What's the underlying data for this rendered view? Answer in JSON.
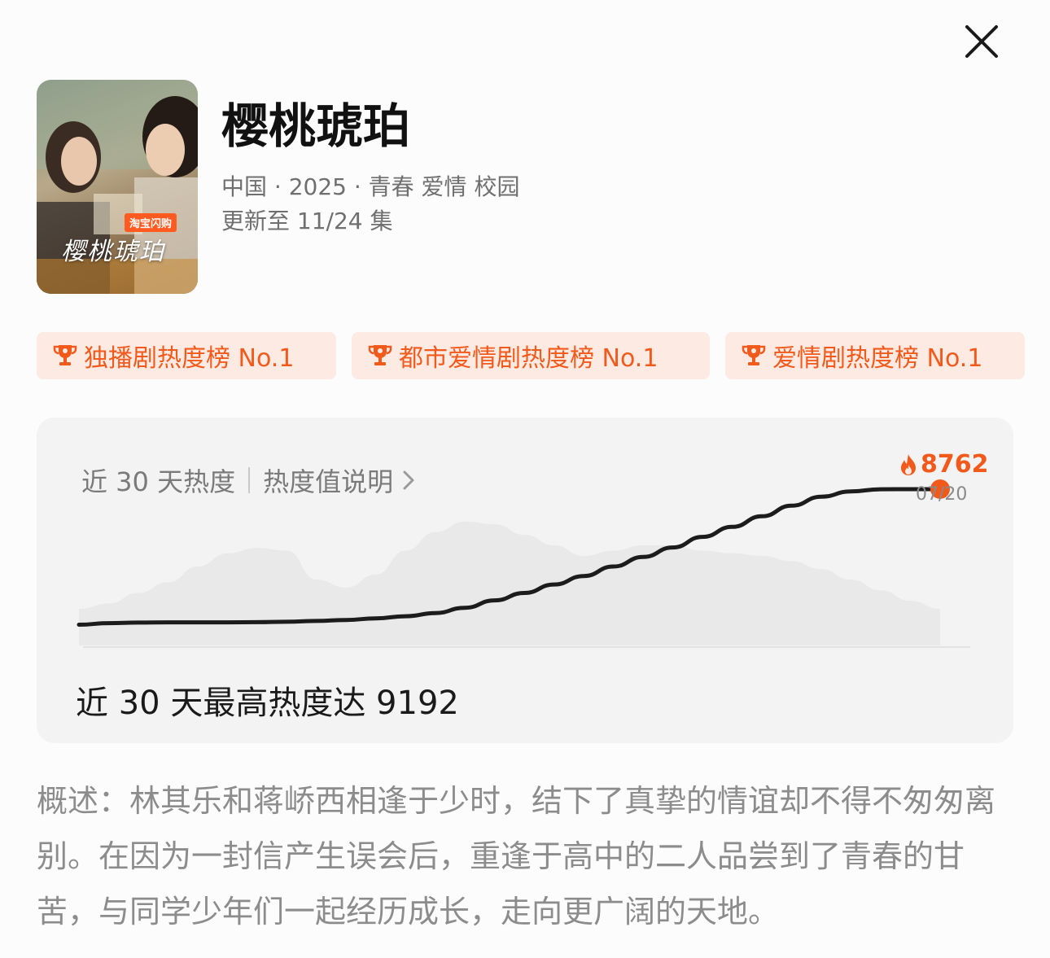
{
  "show": {
    "title": "樱桃琥珀",
    "meta_line1": "中国 · 2025 · 青春 爱情 校园",
    "meta_line2": "更新至 11/24 集",
    "poster": {
      "tag": "淘宝闪购",
      "logo_text": "樱桃琥珀"
    }
  },
  "badges": [
    {
      "label": "独播剧热度榜 No.1"
    },
    {
      "label": "都市爱情剧热度榜 No.1"
    },
    {
      "label": "爱情剧热度榜 No.1"
    }
  ],
  "heat_card": {
    "heading": "近 30 天热度",
    "link_label": "热度值说明",
    "current_value": "8762",
    "current_date": "07/20",
    "peak_text": "近 30 天最高热度达 9192",
    "accent_color": "#f25a1c"
  },
  "chart_data": {
    "type": "line",
    "title": "",
    "xlabel": "",
    "ylabel": "",
    "series": [
      {
        "values": [
          6200,
          6230,
          6240,
          6245,
          6245,
          6245,
          6248,
          6255,
          6270,
          6290,
          6320,
          6360,
          6420,
          6520,
          6660,
          6800,
          6960,
          7120,
          7300,
          7480,
          7660,
          7860,
          8050,
          8250,
          8450,
          8620,
          8720,
          8760,
          8762,
          8762
        ]
      }
    ],
    "highlight": {
      "x": "07/20",
      "value": 8762
    },
    "background_area": [
      6500,
      6600,
      6800,
      7000,
      7300,
      7550,
      7650,
      7600,
      7050,
      6900,
      7150,
      7600,
      7950,
      8150,
      8100,
      7900,
      7700,
      7500,
      7600,
      7700,
      7700,
      7600,
      7550,
      7500,
      7400,
      7250,
      7050,
      6850,
      6650,
      6500
    ]
  },
  "description": "概述：林其乐和蒋峤西相逢于少时，结下了真挚的情谊却不得不匆匆离别。在因为一封信产生误会后，重逢于高中的二人品尝到了青春的甘苦，与同学少年们一起经历成长，走向更广阔的天地。",
  "icons": {
    "close": "close-icon",
    "trophy": "trophy-icon",
    "flame": "flame-icon",
    "chevron": "chevron-right-icon"
  }
}
